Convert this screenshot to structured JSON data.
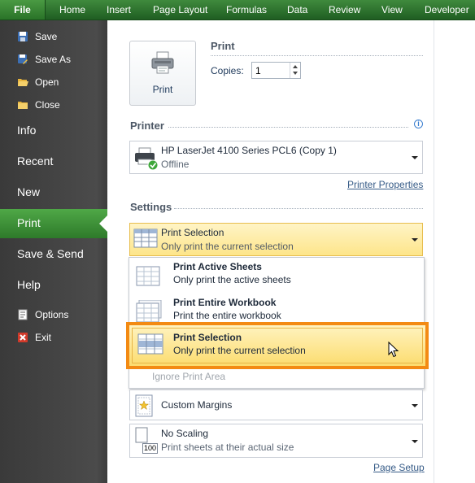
{
  "ribbon": {
    "tabs": [
      "File",
      "Home",
      "Insert",
      "Page Layout",
      "Formulas",
      "Data",
      "Review",
      "View",
      "Developer"
    ]
  },
  "backstage": {
    "quick_commands": [
      {
        "label": "Save",
        "icon": "save-icon"
      },
      {
        "label": "Save As",
        "icon": "save-as-icon"
      },
      {
        "label": "Open",
        "icon": "open-folder-icon"
      },
      {
        "label": "Close",
        "icon": "close-folder-icon"
      }
    ],
    "sections": [
      "Info",
      "Recent",
      "New",
      "Print",
      "Save & Send",
      "Help"
    ],
    "active_section": "Print",
    "bottom_commands": [
      {
        "label": "Options",
        "icon": "options-icon"
      },
      {
        "label": "Exit",
        "icon": "exit-icon"
      }
    ]
  },
  "print": {
    "button_label": "Print",
    "heading": "Print",
    "copies_label": "Copies:",
    "copies_value": "1"
  },
  "printer": {
    "heading": "Printer",
    "name": "HP LaserJet 4100 Series PCL6 (Copy 1)",
    "status": "Offline",
    "properties_link": "Printer Properties"
  },
  "settings": {
    "heading": "Settings",
    "selected": {
      "title": "Print Selection",
      "desc": "Only print the current selection"
    },
    "options": [
      {
        "title": "Print Active Sheets",
        "desc": "Only print the active sheets"
      },
      {
        "title": "Print Entire Workbook",
        "desc": "Print the entire workbook"
      },
      {
        "title": "Print Selection",
        "desc": "Only print the current selection"
      }
    ],
    "ignore_print_area": "Ignore Print Area",
    "margins": "Custom Margins",
    "scaling": {
      "title": "No Scaling",
      "desc": "Print sheets at their actual size",
      "icon_text": "100"
    },
    "page_setup_link": "Page Setup"
  },
  "colors": {
    "file_tab": "#2a7328",
    "backstage_bg": "#444444",
    "active_item": "#3f9238",
    "highlight_border": "#f38a13",
    "selected_fill": "#fde58a"
  }
}
